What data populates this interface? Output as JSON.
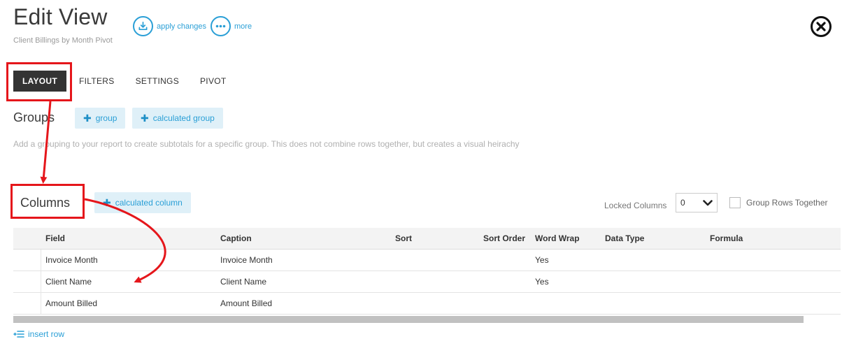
{
  "header": {
    "title": "Edit View",
    "subtitle": "Client Billings by Month Pivot",
    "apply_changes_label": "apply changes",
    "more_label": "more"
  },
  "tabs": [
    {
      "label": "LAYOUT",
      "active": true
    },
    {
      "label": "FILTERS",
      "active": false
    },
    {
      "label": "SETTINGS",
      "active": false
    },
    {
      "label": "PIVOT",
      "active": false
    }
  ],
  "groups": {
    "title": "Groups",
    "add_group_label": "group",
    "add_calculated_group_label": "calculated group",
    "help_text": "Add a grouping to your report to create subtotals for a specific group. This does not combine rows together, but creates a visual heirachy"
  },
  "columns": {
    "title": "Columns",
    "add_calculated_column_label": "calculated column",
    "locked_columns_label": "Locked Columns",
    "locked_columns_value": "0",
    "group_rows_label": "Group Rows Together",
    "group_rows_checked": false,
    "headers": {
      "field": "Field",
      "caption": "Caption",
      "sort": "Sort",
      "sort_order": "Sort Order",
      "word_wrap": "Word Wrap",
      "data_type": "Data Type",
      "formula": "Formula"
    },
    "rows": [
      {
        "field": "Invoice Month",
        "caption": "Invoice Month",
        "sort": "",
        "sort_order": "",
        "word_wrap": "Yes",
        "data_type": "",
        "formula": ""
      },
      {
        "field": "Client Name",
        "caption": "Client Name",
        "sort": "",
        "sort_order": "",
        "word_wrap": "Yes",
        "data_type": "",
        "formula": ""
      },
      {
        "field": "Amount Billed",
        "caption": "Amount Billed",
        "sort": "",
        "sort_order": "",
        "word_wrap": "",
        "data_type": "",
        "formula": ""
      }
    ],
    "insert_row_label": "insert row"
  },
  "colors": {
    "accent": "#2a9fd6",
    "annotation": "#e5161b",
    "active_tab": "#333333"
  }
}
